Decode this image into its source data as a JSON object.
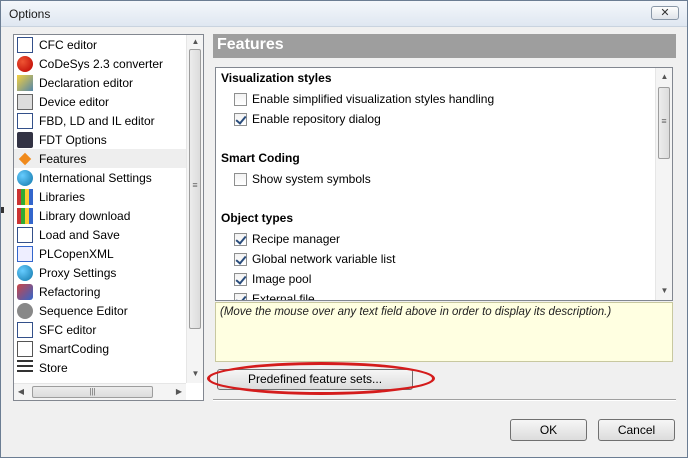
{
  "window": {
    "title": "Options",
    "close_glyph": "✕"
  },
  "nav": {
    "items": [
      {
        "label": "CFC editor",
        "icon": "cfc-editor-icon"
      },
      {
        "label": "CoDeSys 2.3 converter",
        "icon": "converter-icon"
      },
      {
        "label": "Declaration editor",
        "icon": "declaration-editor-icon"
      },
      {
        "label": "Device editor",
        "icon": "device-editor-icon"
      },
      {
        "label": "FBD, LD and IL editor",
        "icon": "fbd-editor-icon"
      },
      {
        "label": "FDT Options",
        "icon": "fdt-icon"
      },
      {
        "label": "Features",
        "icon": "features-icon",
        "selected": true
      },
      {
        "label": "International Settings",
        "icon": "globe-icon"
      },
      {
        "label": "Libraries",
        "icon": "libraries-icon"
      },
      {
        "label": "Library download",
        "icon": "library-download-icon"
      },
      {
        "label": "Load and Save",
        "icon": "load-save-icon"
      },
      {
        "label": "PLCopenXML",
        "icon": "plcopenxml-icon"
      },
      {
        "label": "Proxy Settings",
        "icon": "proxy-icon"
      },
      {
        "label": "Refactoring",
        "icon": "refactoring-icon"
      },
      {
        "label": "Sequence Editor",
        "icon": "sequence-editor-icon"
      },
      {
        "label": "SFC editor",
        "icon": "sfc-editor-icon"
      },
      {
        "label": "SmartCoding",
        "icon": "smartcoding-icon"
      },
      {
        "label": "Store",
        "icon": "store-icon"
      }
    ],
    "scroll_glyphs": {
      "up": "▲",
      "down": "▼",
      "left": "◀",
      "right": "▶",
      "grip": "≡",
      "hgrip": "|||"
    }
  },
  "panel": {
    "header": "Features",
    "sections": [
      {
        "title": "Visualization styles",
        "options": [
          {
            "label": "Enable simplified visualization styles handling",
            "checked": false
          },
          {
            "label": "Enable repository dialog",
            "checked": true
          }
        ]
      },
      {
        "title": "Smart Coding",
        "options": [
          {
            "label": "Show system symbols",
            "checked": false
          }
        ]
      },
      {
        "title": "Object types",
        "options": [
          {
            "label": "Recipe manager",
            "checked": true
          },
          {
            "label": "Global network variable list",
            "checked": true
          },
          {
            "label": "Image pool",
            "checked": true
          },
          {
            "label": "External file",
            "checked": true
          }
        ]
      }
    ],
    "description": "(Move the mouse over any text field above in order to display its description.)",
    "predefined_button": "Predefined feature sets...",
    "highlight_color": "#d41c1c"
  },
  "footer": {
    "ok": "OK",
    "cancel": "Cancel"
  }
}
